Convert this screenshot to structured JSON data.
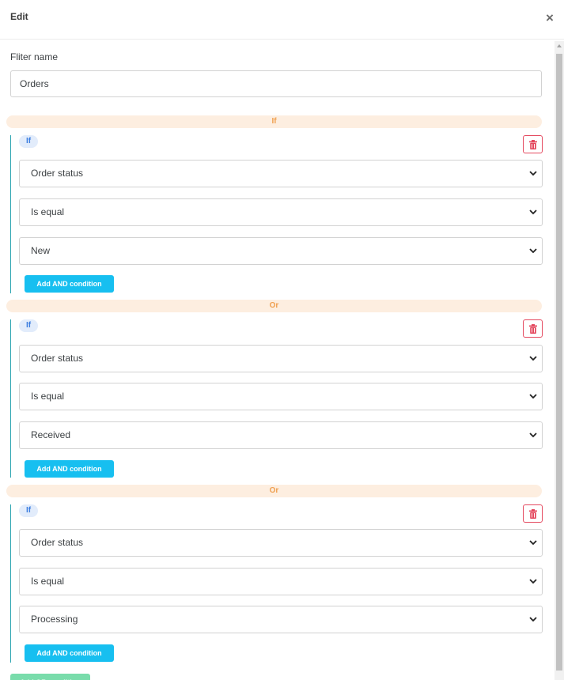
{
  "modal": {
    "title": "Edit",
    "close_symbol": "×"
  },
  "filter_name": {
    "label": "Fliter name",
    "value": "Orders"
  },
  "joiners": [
    "If",
    "Or",
    "Or"
  ],
  "groups": [
    {
      "badge": "If",
      "field": "Order status",
      "operator": "Is equal",
      "value": "New",
      "add_and_label": "Add AND condition"
    },
    {
      "badge": "If",
      "field": "Order status",
      "operator": "Is equal",
      "value": "Received",
      "add_and_label": "Add AND condition"
    },
    {
      "badge": "If",
      "field": "Order status",
      "operator": "Is equal",
      "value": "Processing",
      "add_and_label": "Add AND condition"
    }
  ],
  "add_or_label": "Add OR condition",
  "icons": {
    "delete": "trash-icon",
    "close": "close-icon",
    "select": "chevron-down-icon"
  },
  "colors": {
    "accent_button": "#17bff0",
    "delete_red": "#e4485e",
    "joiner_bg": "#fdeee0",
    "joiner_text": "#f0a050",
    "group_border": "#2aa4b0",
    "badge_bg": "#e2ecfb",
    "badge_text": "#3d7ee0",
    "or_button": "#79dcab"
  }
}
